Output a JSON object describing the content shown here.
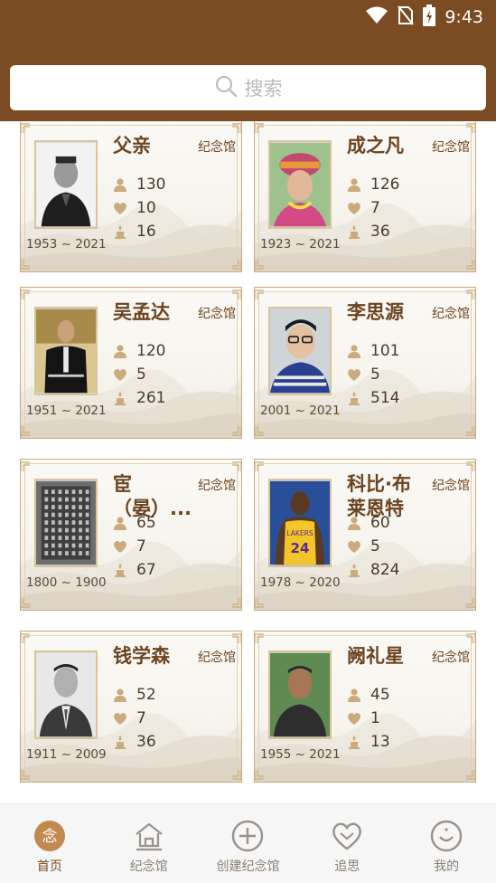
{
  "status_bar": {
    "time": "9:43"
  },
  "search": {
    "placeholder": "搜索"
  },
  "hall_label": "纪念馆",
  "cards": [
    {
      "name": "父亲",
      "years": "1953 ~ 2021",
      "visitors": "130",
      "likes": "10",
      "candles": "16",
      "photo": "man-dark-jacket"
    },
    {
      "name": "成之凡",
      "years": "1923 ~ 2021",
      "visitors": "126",
      "likes": "7",
      "candles": "36",
      "photo": "woman-colorful-hat"
    },
    {
      "name": "吴孟达",
      "years": "1951 ~ 2021",
      "visitors": "120",
      "likes": "5",
      "candles": "261",
      "photo": "man-black-tunic"
    },
    {
      "name": "李思源",
      "years": "2001 ~ 2021",
      "visitors": "101",
      "likes": "5",
      "candles": "514",
      "photo": "young-man-glasses"
    },
    {
      "name": "宦（晏）...",
      "years": "1800 ~ 1900",
      "visitors": "65",
      "likes": "7",
      "candles": "67",
      "photo": "stone-tablet"
    },
    {
      "name": "科比·布莱恩特",
      "years": "1978 ~ 2020",
      "visitors": "60",
      "likes": "5",
      "candles": "824",
      "photo": "basketball-player-24"
    },
    {
      "name": "钱学森",
      "years": "1911 ~ 2009",
      "visitors": "52",
      "likes": "7",
      "candles": "36",
      "photo": "man-suit-bw"
    },
    {
      "name": "阙礼星",
      "years": "1955 ~ 2021",
      "visitors": "45",
      "likes": "1",
      "candles": "13",
      "photo": "older-man"
    }
  ],
  "nav": [
    {
      "label": "首页",
      "icon": "home-memorial-icon",
      "active": true
    },
    {
      "label": "纪念馆",
      "icon": "hall-icon",
      "active": false
    },
    {
      "label": "创建纪念馆",
      "icon": "plus-circle-icon",
      "active": false
    },
    {
      "label": "追思",
      "icon": "heart-icon",
      "active": false
    },
    {
      "label": "我的",
      "icon": "smile-icon",
      "active": false
    }
  ],
  "colors": {
    "brand": "#7b4b23",
    "card_border": "#c9ab7d",
    "stat_icon": "#c9ab7d"
  }
}
